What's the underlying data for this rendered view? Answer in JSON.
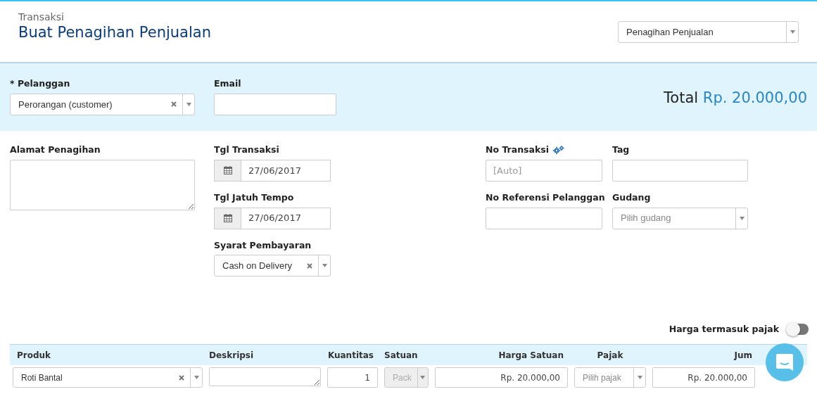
{
  "header": {
    "breadcrumb": "Transaksi",
    "title": "Buat Penagihan Penjualan",
    "type_select": {
      "value": "Penagihan Penjualan"
    }
  },
  "top_fields": [
    {
      "kind": "select",
      "label": "* Pelanggan",
      "value": "Perorangan (customer)",
      "clearable": true
    },
    {
      "kind": "input",
      "label": "Email"
    }
  ],
  "total": {
    "label": "Total",
    "amount": "Rp. 20.000,00"
  },
  "form_columns": [
    [
      {
        "kind": "textarea",
        "label": "Alamat Penagihan"
      }
    ],
    [
      {
        "kind": "date",
        "label": "Tgl Transaksi",
        "value": "27/06/2017"
      },
      {
        "kind": "date",
        "label": "Tgl Jatuh Tempo",
        "value": "27/06/2017"
      },
      {
        "kind": "select",
        "label": "Syarat Pembayaran",
        "value": "Cash on Delivery",
        "clearable": true
      }
    ],
    [
      {
        "kind": "input",
        "label": "No Transaksi",
        "placeholder": "[Auto]",
        "settings": true
      },
      {
        "kind": "input",
        "label": "No Referensi Pelanggan"
      }
    ],
    [
      {
        "kind": "input",
        "label": "Tag"
      },
      {
        "kind": "select",
        "label": "Gudang",
        "placeholder": "Pilih gudang"
      }
    ]
  ],
  "tax_toggle": {
    "label": "Harga termasuk pajak",
    "on": false
  },
  "table": {
    "columns": [
      "Produk",
      "Deskripsi",
      "Kuantitas",
      "Satuan",
      "Harga Satuan",
      "Pajak",
      "Jum"
    ],
    "rows": [
      [
        {
          "kind": "select",
          "value": "Roti Bantal",
          "clearable": true
        },
        {
          "kind": "textarea"
        },
        {
          "kind": "number",
          "value": "1"
        },
        {
          "kind": "select",
          "value": "Pack",
          "disabled": true
        },
        {
          "kind": "money",
          "value": "Rp. 20.000,00"
        },
        {
          "kind": "select",
          "placeholder": "Pilih pajak"
        },
        {
          "kind": "money",
          "value": "Rp. 20.000,00"
        }
      ]
    ]
  }
}
